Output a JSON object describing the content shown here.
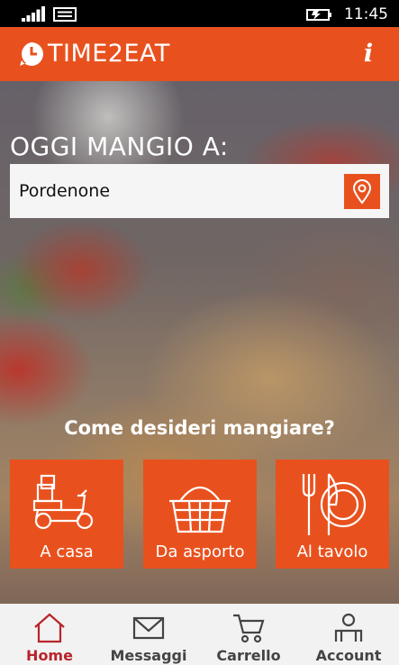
{
  "status_bar": {
    "time": "11:45",
    "icons": [
      "signal-icon",
      "message-icon",
      "battery-icon"
    ]
  },
  "header": {
    "app_name": "TIME2EAT",
    "logo_icon": "clock-icon",
    "info_icon": "info-icon"
  },
  "location": {
    "heading": "OGGI MANGIO A:",
    "city_value": "Pordenone",
    "locate_icon": "map-pin-icon"
  },
  "dining": {
    "question": "Come desideri mangiare?",
    "options": [
      {
        "label": "A casa",
        "icon": "delivery-scooter-icon"
      },
      {
        "label": "Da asporto",
        "icon": "basket-icon"
      },
      {
        "label": "Al tavolo",
        "icon": "plate-cutlery-icon"
      }
    ]
  },
  "bottom_nav": {
    "items": [
      {
        "label": "Home",
        "icon": "home-icon",
        "active": true
      },
      {
        "label": "Messaggi",
        "icon": "envelope-icon"
      },
      {
        "label": "Carrello",
        "icon": "cart-icon"
      },
      {
        "label": "Account",
        "icon": "account-icon"
      }
    ]
  },
  "colors": {
    "accent": "#e8511e",
    "active_nav": "#b8242a",
    "nav_bg": "#f2f2f2"
  }
}
